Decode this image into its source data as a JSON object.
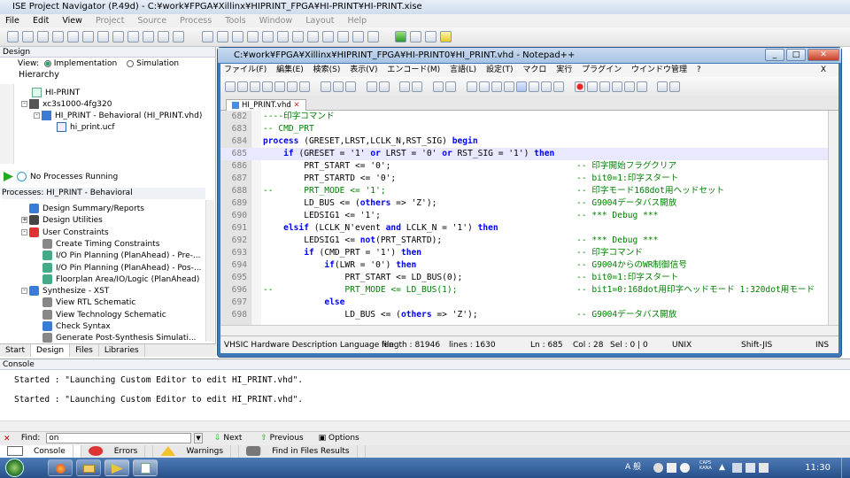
{
  "ise": {
    "title": "ISE Project Navigator (P.49d) - C:¥work¥FPGA¥Xillinx¥HIPRINT_FPGA¥HI-PRINT¥HI-PRINT.xise",
    "menu": [
      "File",
      "Edit",
      "View",
      "Project",
      "Source",
      "Process",
      "Tools",
      "Window",
      "Layout",
      "Help"
    ]
  },
  "design_panel": {
    "header": "Design",
    "view_label": "View:",
    "implementation": "Implementation",
    "simulation": "Simulation",
    "hierarchy_label": "Hierarchy",
    "hierarchy": [
      {
        "label": "HI-PRINT"
      },
      {
        "label": "xc3s1000-4fg320"
      },
      {
        "label": "HI_PRINT - Behavioral (HI_PRINT.vhd)"
      },
      {
        "label": "hi_print.ucf"
      }
    ],
    "no_processes": "No Processes Running",
    "processes_label": "Processes: HI_PRINT - Behavioral",
    "processes": [
      {
        "label": "Design Summary/Reports",
        "indent": 1
      },
      {
        "label": "Design Utilities",
        "indent": 1
      },
      {
        "label": "User Constraints",
        "indent": 1
      },
      {
        "label": "Create Timing Constraints",
        "indent": 2
      },
      {
        "label": "I/O Pin Planning (PlanAhead) - Pre-...",
        "indent": 2
      },
      {
        "label": "I/O Pin Planning (PlanAhead) - Pos-...",
        "indent": 2
      },
      {
        "label": "Floorplan Area/IO/Logic (PlanAhead)",
        "indent": 2
      },
      {
        "label": "Synthesize - XST",
        "indent": 1
      },
      {
        "label": "View RTL Schematic",
        "indent": 2
      },
      {
        "label": "View Technology Schematic",
        "indent": 2
      },
      {
        "label": "Check Syntax",
        "indent": 2
      },
      {
        "label": "Generate Post-Synthesis Simulati...",
        "indent": 2
      }
    ],
    "tabs": [
      "Start",
      "Design",
      "Files",
      "Libraries"
    ]
  },
  "npp": {
    "title": "C:¥work¥FPGA¥Xillinx¥HIPRINT_FPGA¥HI-PRINT0¥HI_PRINT.vhd - Notepad++",
    "menu": [
      "ファイル(F)",
      "編集(E)",
      "検索(S)",
      "表示(V)",
      "エンコード(M)",
      "言語(L)",
      "設定(T)",
      "マクロ",
      "実行",
      "プラグイン",
      "ウインドウ管理",
      "?"
    ],
    "tab": "HI_PRINT.vhd",
    "lines": [
      {
        "n": "682",
        "code": "----印字コマンド",
        "cmt": ""
      },
      {
        "n": "683",
        "code": "-- CMD_PRT",
        "cmt": ""
      },
      {
        "n": "684",
        "code": "process (GRESET,LRST,LCLK_N,RST_SIG) begin",
        "cmt": ""
      },
      {
        "n": "685",
        "code": "    if (GRESET = '1' or LRST = '0' or RST_SIG = '1') then",
        "cmt": ""
      },
      {
        "n": "686",
        "code": "        PRT_START <= '0';",
        "cmt": "-- 印字開始フラグクリア"
      },
      {
        "n": "687",
        "code": "        PRT_STARTD <= '0';",
        "cmt": "-- bit0=1:印字スタート"
      },
      {
        "n": "688",
        "code": "--      PRT_MODE <= '1';",
        "cmt": "-- 印字モード168dot用ヘッドセット"
      },
      {
        "n": "689",
        "code": "        LD_BUS <= (others => 'Z');",
        "cmt": "-- G9004データバス開放"
      },
      {
        "n": "690",
        "code": "        LEDSIG1 <= '1';",
        "cmt": "-- *** Debug ***"
      },
      {
        "n": "691",
        "code": "    elsif (LCLK_N'event and LCLK_N = '1') then",
        "cmt": ""
      },
      {
        "n": "692",
        "code": "        LEDSIG1 <= not(PRT_STARTD);",
        "cmt": "-- *** Debug ***"
      },
      {
        "n": "693",
        "code": "        if (CMD_PRT = '1') then",
        "cmt": "-- 印字コマンド"
      },
      {
        "n": "694",
        "code": "            if(LWR = '0') then",
        "cmt": "-- G9004からのWR制御信号"
      },
      {
        "n": "695",
        "code": "                PRT_START <= LD_BUS(0);",
        "cmt": "-- bit0=1:印字スタート"
      },
      {
        "n": "696",
        "code": "--              PRT_MODE <= LD_BUS(1);",
        "cmt": "-- bit1=0:168dot用印字ヘッドモード 1:320dot用モード"
      },
      {
        "n": "697",
        "code": "            else",
        "cmt": ""
      },
      {
        "n": "698",
        "code": "                LD_BUS <= (others => 'Z');",
        "cmt": "-- G9004データバス開放"
      }
    ],
    "status": {
      "lang": "VHSIC Hardware Description Language file",
      "length": "length : 81946",
      "lines": "lines : 1630",
      "pos": "Ln : 685",
      "col": "Col : 28",
      "sel": "Sel : 0 | 0",
      "eol": "UNIX",
      "enc": "Shift-JIS",
      "ins": "INS"
    }
  },
  "console": {
    "header": "Console",
    "lines": [
      "Started : \"Launching Custom Editor to edit HI_PRINT.vhd\".",
      "Started : \"Launching Custom Editor to edit HI_PRINT.vhd\"."
    ],
    "find_label": "Find:",
    "find_value": "on",
    "next": "Next",
    "previous": "Previous",
    "options": "Options",
    "tabs": [
      "Console",
      "Errors",
      "Warnings",
      "Find in Files Results"
    ]
  },
  "taskbar": {
    "ime": "A 般",
    "caps": "CAPS KANA",
    "time": "11:30"
  },
  "colors": {
    "keyword": "#0000ff",
    "comment": "#008000",
    "npp_frame": "#3f78b8",
    "taskbar": "#28508a"
  }
}
